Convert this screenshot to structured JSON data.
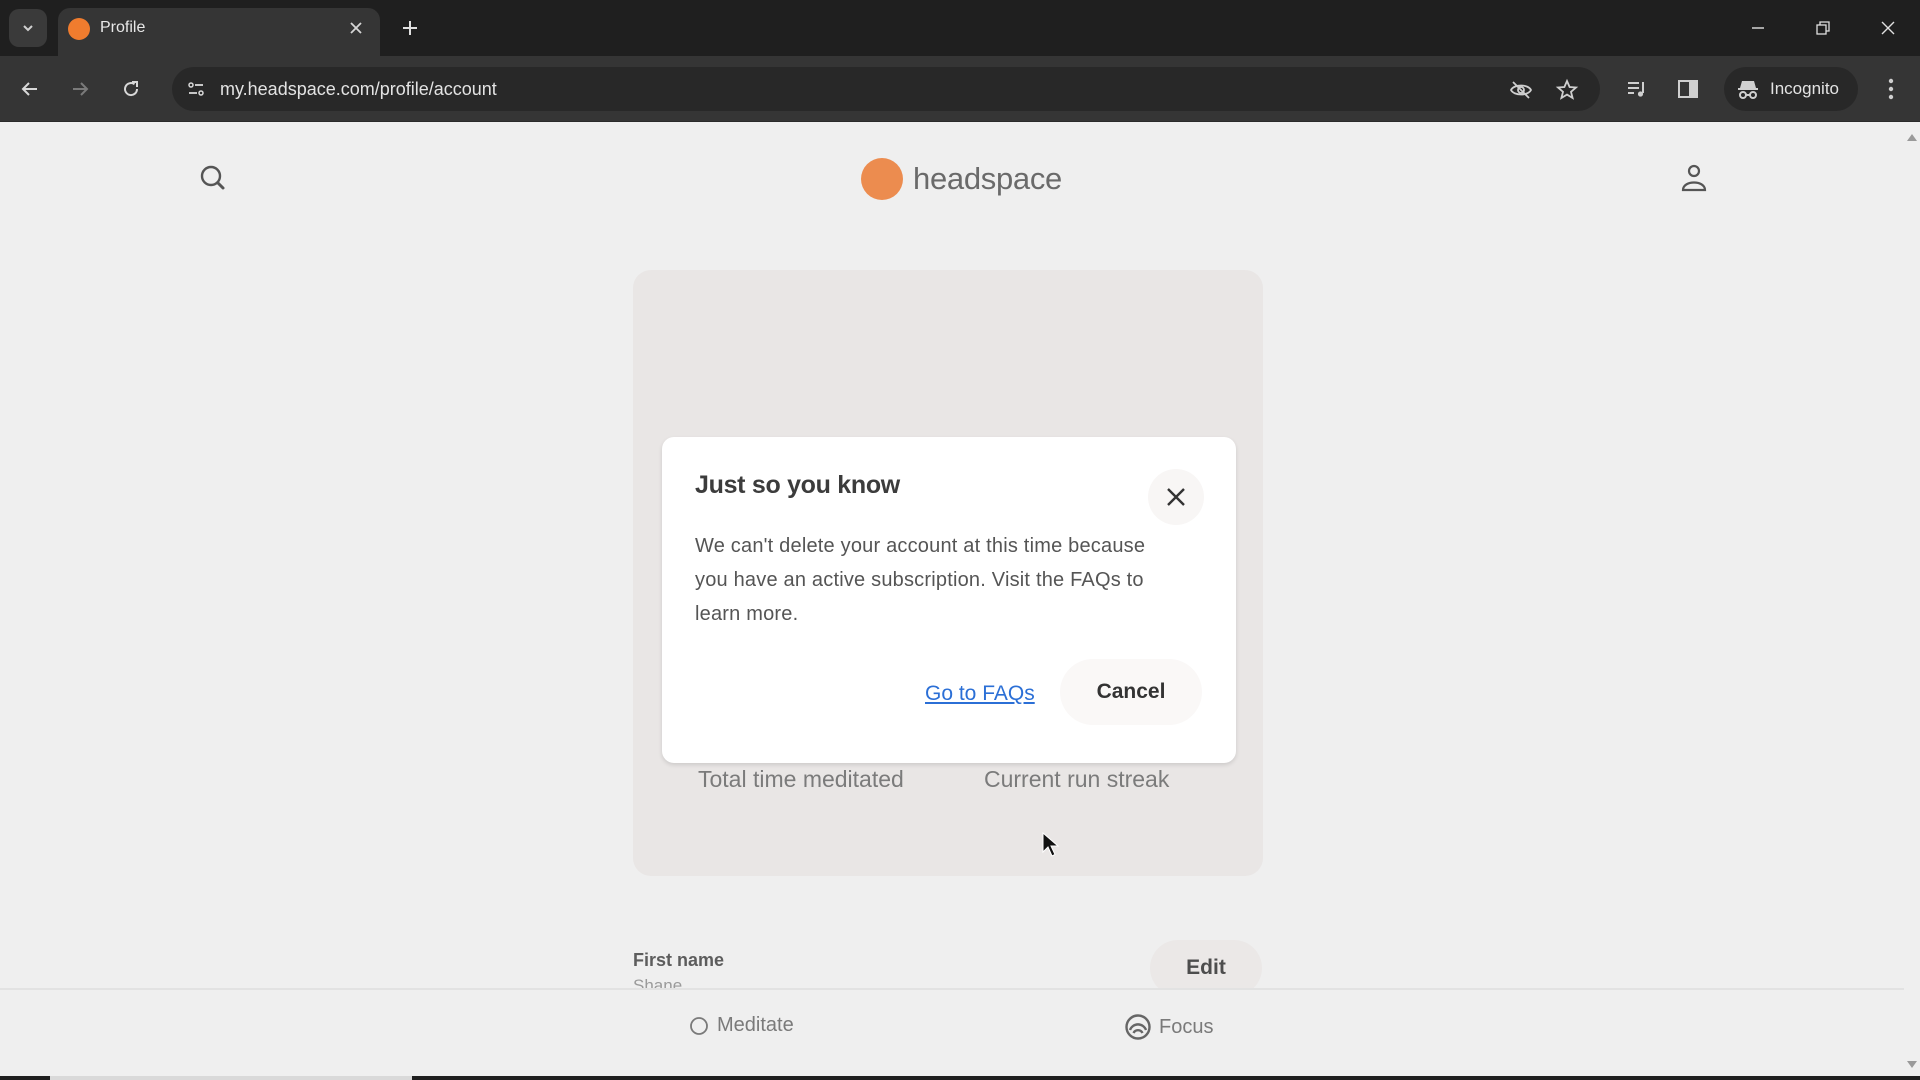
{
  "browser": {
    "tab": {
      "title": "Profile",
      "favicon_color": "#f07c2e"
    },
    "new_tab_icon": "plus-icon",
    "url": "my.headspace.com/profile/account",
    "incognito_label": "Incognito",
    "window_controls": [
      "minimize",
      "restore",
      "close"
    ]
  },
  "header": {
    "logo_text": "headspace",
    "logo_color": "#ec8c4f",
    "search_icon": "search-icon",
    "user_icon": "user-icon"
  },
  "profile_card": {
    "avatar": "cloud-avatar",
    "avatar_color": "#3fa8ec",
    "stats": [
      {
        "label": "Total time meditated"
      },
      {
        "label": "Current run streak"
      }
    ]
  },
  "account_fields": [
    {
      "label": "First name",
      "value": "Shane",
      "action": "Edit"
    }
  ],
  "bottom_nav": [
    {
      "label": "Meditate",
      "icon": "circle-icon"
    },
    {
      "label": "Focus",
      "icon": "focus-icon"
    }
  ],
  "modal": {
    "title": "Just so you know",
    "body": "We can't delete your account at this time because you have an active subscription. Visit the FAQs to learn more.",
    "link_label": "Go to FAQs",
    "cancel_label": "Cancel",
    "link_color": "#2b6fd6"
  }
}
